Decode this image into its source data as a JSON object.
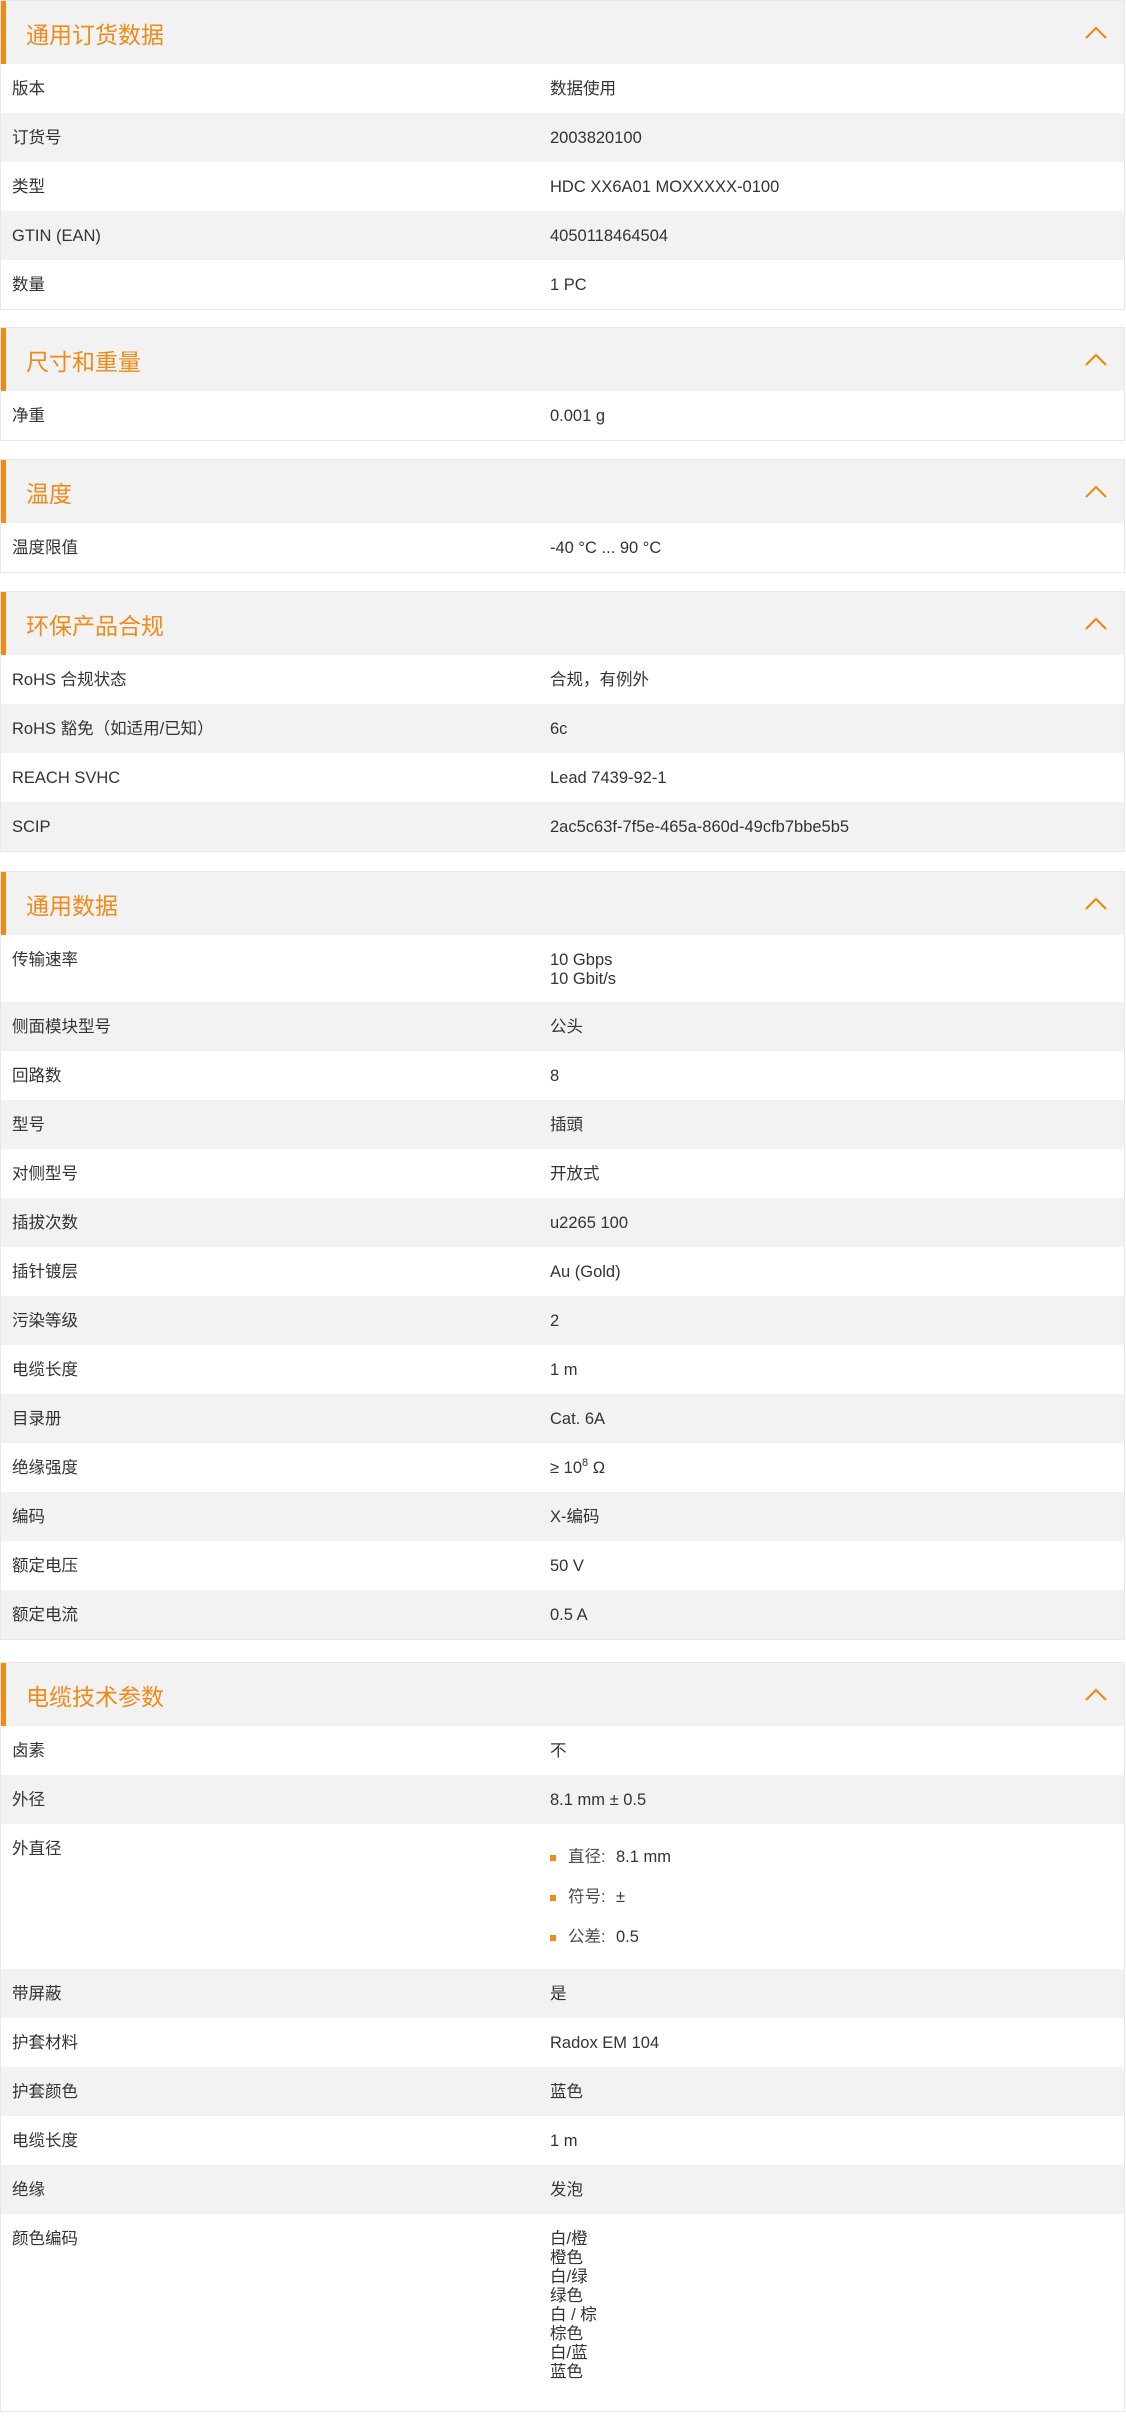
{
  "accent_color": "#f08a18",
  "row_alt_color": "#f2f2f2",
  "icons": {
    "collapse": "chevron-up-icon",
    "list_bullet": "orange-square-bullet"
  },
  "sections": {
    "ordering": {
      "title": "通用订货数据",
      "rows": [
        {
          "label": "版本",
          "value": "数据使用"
        },
        {
          "label": "订货号",
          "value": "2003820100"
        },
        {
          "label": "类型",
          "value": "HDC XX6A01 MOXXXXX-0100"
        },
        {
          "label": "GTIN (EAN)",
          "value": "4050118464504"
        },
        {
          "label": "数量",
          "value": "1  PC"
        }
      ]
    },
    "dimensions": {
      "title": "尺寸和重量",
      "rows": [
        {
          "label": "净重",
          "value": "0.001  g"
        }
      ]
    },
    "temperature": {
      "title": "温度",
      "rows": [
        {
          "label": "温度限值",
          "value": "-40 °C ... 90 °C"
        }
      ]
    },
    "compliance": {
      "title": "环保产品合规",
      "rows": [
        {
          "label": "RoHS 合规状态",
          "value": "合规，有例外"
        },
        {
          "label": "RoHS 豁免（如适用/已知）",
          "value": "6c"
        },
        {
          "label": "REACH SVHC",
          "value": "Lead 7439-92-1"
        },
        {
          "label": "SCIP",
          "value": "2ac5c63f-7f5e-465a-860d-49cfb7bbe5b5"
        }
      ]
    },
    "general": {
      "title": "通用数据",
      "transfer_rate": {
        "label": "传输速率",
        "line1": "10 Gbps",
        "line2": "10 Gbit/s"
      },
      "rows": [
        {
          "label": "侧面模块型号",
          "value": "公头"
        },
        {
          "label": "回路数",
          "value": "8"
        },
        {
          "label": "型号",
          "value": "插頭"
        },
        {
          "label": "对侧型号",
          "value": "开放式"
        },
        {
          "label": "插拔次数",
          "value": "u2265 100"
        },
        {
          "label": "插针镀层",
          "value": "Au (Gold)"
        },
        {
          "label": "污染等级",
          "value": "2"
        },
        {
          "label": "电缆长度",
          "value": "1  m"
        },
        {
          "label": "目录册",
          "value": "Cat. 6A"
        }
      ],
      "insulation": {
        "label": "绝缘强度",
        "prefix": "≥ 10",
        "exponent": "8",
        "suffix": " Ω"
      },
      "rows2": [
        {
          "label": "编码",
          "value": "X-编码"
        },
        {
          "label": "额定电压",
          "value": "50  V"
        },
        {
          "label": "额定电流",
          "value": "0.5  A"
        }
      ]
    },
    "cable": {
      "title": "电缆技术参数",
      "rows": [
        {
          "label": "卤素",
          "value": "不"
        },
        {
          "label": "外径",
          "value": "8.1 mm ± 0.5"
        }
      ],
      "outer_diameter": {
        "label": "外直径",
        "items": [
          {
            "label": "直径:",
            "value": "8.1 mm"
          },
          {
            "label": "符号:",
            "value": "±"
          },
          {
            "label": "公差:",
            "value": "0.5"
          }
        ]
      },
      "rows2": [
        {
          "label": "带屏蔽",
          "value": "是"
        },
        {
          "label": "护套材料",
          "value": "Radox EM 104"
        },
        {
          "label": "护套颜色",
          "value": "蓝色"
        },
        {
          "label": "电缆长度",
          "value": "1  m"
        },
        {
          "label": "绝缘",
          "value": "发泡"
        }
      ],
      "color_code": {
        "label": "颜色编码",
        "lines": [
          "白/橙",
          "橙色",
          "白/绿",
          "绿色",
          "白 / 棕",
          "棕色",
          "白/蓝",
          "蓝色"
        ]
      }
    }
  }
}
